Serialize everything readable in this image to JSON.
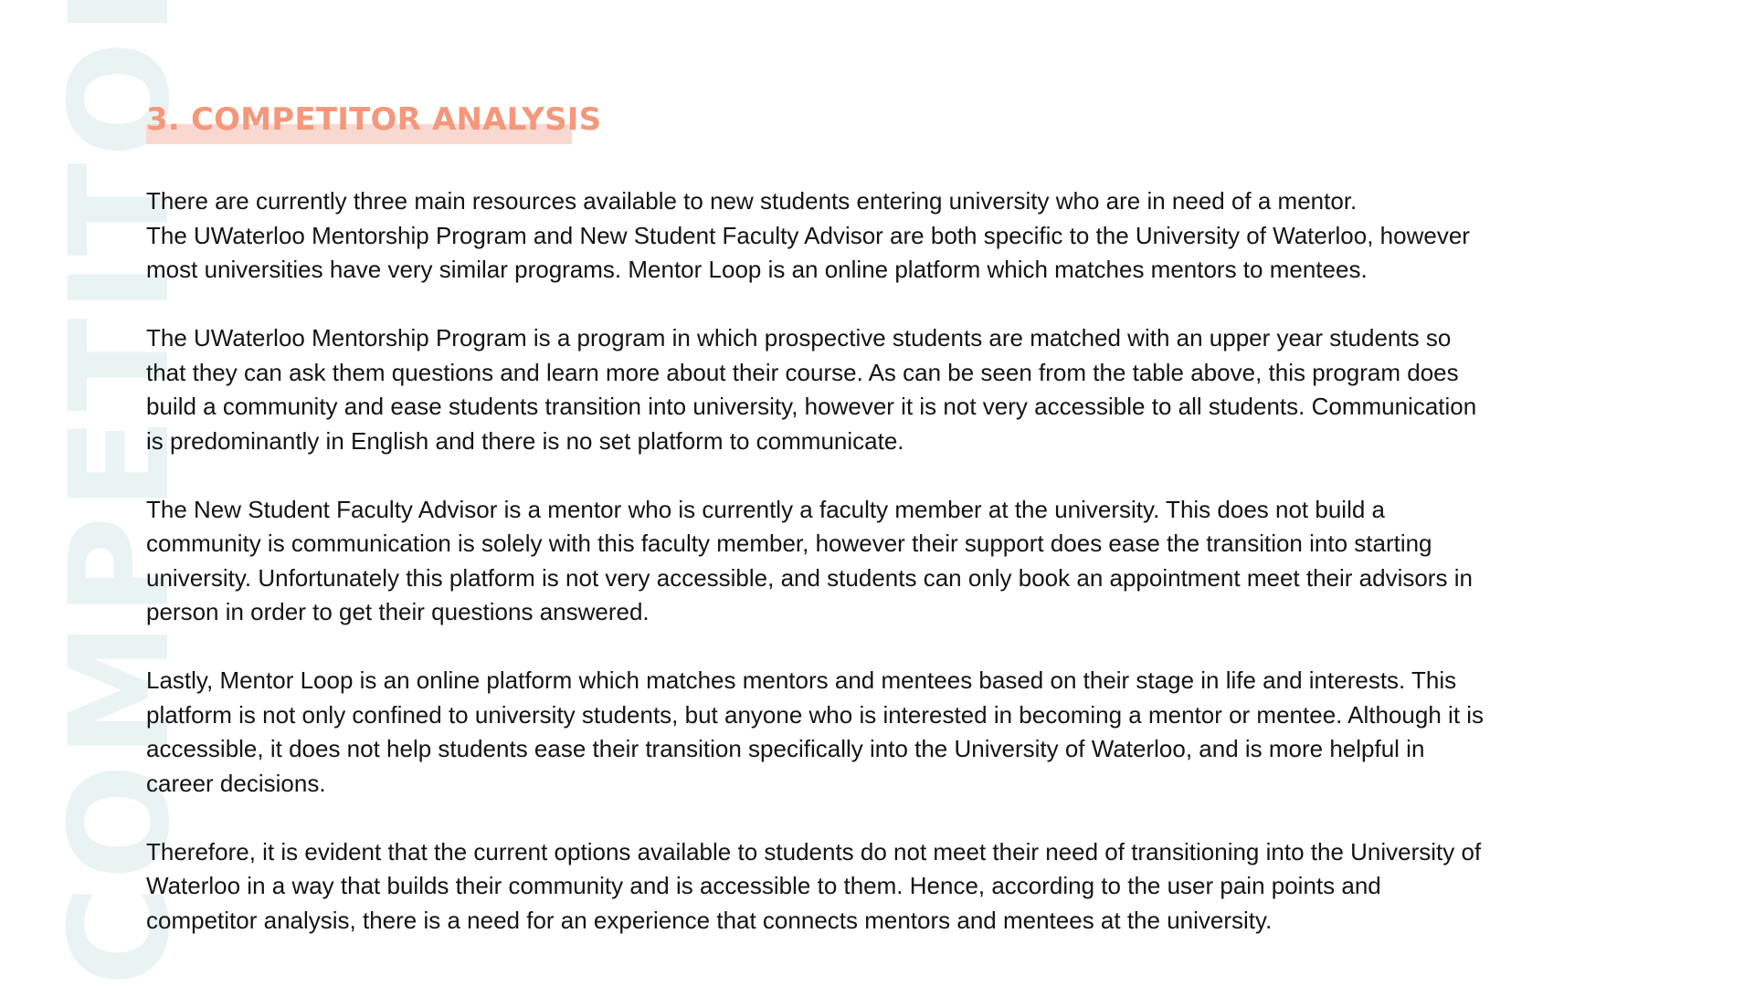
{
  "watermark": "COMPETITOR ANALYSIS",
  "title": "3. COMPETITOR ANALYSIS",
  "colors": {
    "title": "#f5977a",
    "title_highlight": "#f9d8d1",
    "watermark": "#eaf3f3",
    "body_text": "#141414"
  },
  "paragraphs": [
    {
      "lines": [
        "There are currently three main resources available to new students entering university who are in need of a mentor.",
        "The UWaterloo Mentorship Program and New Student Faculty Advisor are both specific to the University of Waterloo, however",
        "most universities have very similar programs. Mentor Loop is an online platform which matches mentors to mentees."
      ]
    },
    {
      "lines": [
        "The UWaterloo Mentorship Program is a program in which prospective students are matched with an upper year students so",
        "that they can ask them questions and learn more about their course. As can be seen from the table above, this program does",
        "build a community and ease students transition into university, however it is not very accessible to all students. Communication",
        "is predominantly in English and there is no set platform to communicate."
      ]
    },
    {
      "lines": [
        "The New Student Faculty Advisor is a mentor who is currently a faculty member at the university. This does not build a",
        "community is communication is solely with this faculty member, however their support does ease the transition into starting",
        "university. Unfortunately this platform is not very accessible, and students can only book an appointment meet their advisors in",
        "person in order to get their questions answered."
      ]
    },
    {
      "lines": [
        "Lastly, Mentor Loop is an online platform which matches mentors and mentees based on their stage in life and interests. This",
        "platform is not only confined to university students, but anyone who is interested in becoming a mentor or mentee. Although it is",
        "accessible, it does not help students ease their transition specifically into the University of Waterloo, and is more helpful in",
        "career decisions."
      ]
    },
    {
      "lines": [
        "Therefore, it is evident that the current options available to students do not meet their need of transitioning into the University of",
        "Waterloo in a way that builds their community and is accessible to them. Hence, according to the user pain points and",
        "competitor analysis, there is a need for an experience that connects mentors and mentees at the university."
      ]
    }
  ]
}
